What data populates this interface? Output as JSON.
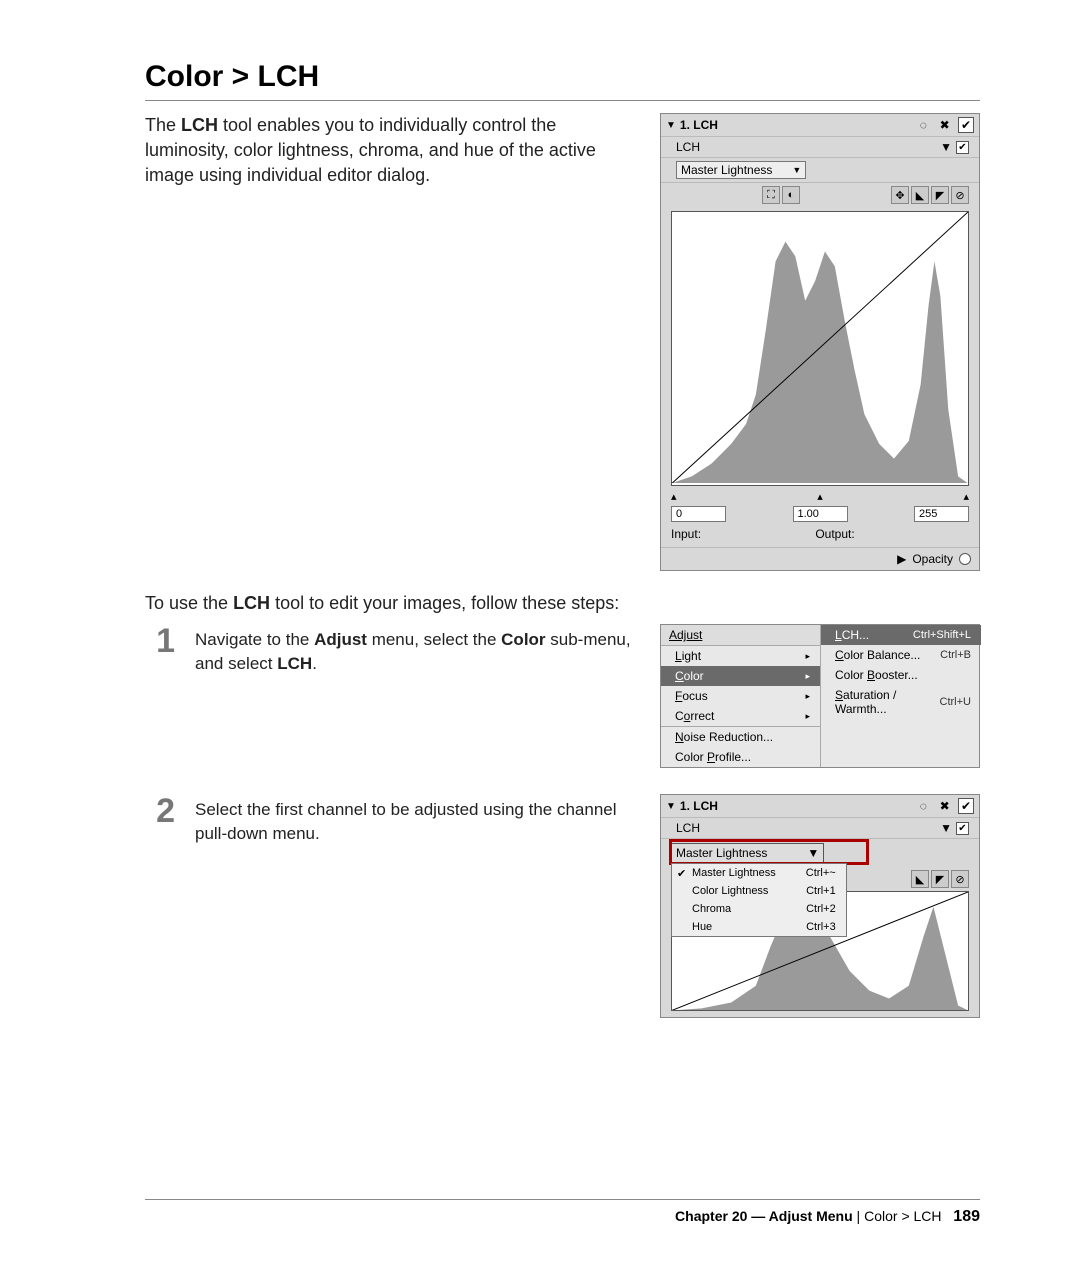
{
  "heading": "Color > LCH",
  "intro": "The LCH tool enables you to individually control the luminosity, color lightness, chroma, and hue of the active image using individual editor dialog.",
  "intro_bold": "LCH",
  "panel1": {
    "title": "1. LCH",
    "type_label": "LCH",
    "channel": "Master Lightness",
    "val_low": "0",
    "val_mid": "1.00",
    "val_high": "255",
    "input_label": "Input:",
    "output_label": "Output:",
    "opacity_label": "Opacity"
  },
  "steps_intro": "To use the LCH tool to edit your images, follow these steps:",
  "step1": {
    "num": "1",
    "text_before": "Navigate to the ",
    "b1": "Adjust",
    "mid1": " menu, select the ",
    "b2": "Color",
    "mid2": " sub-menu, and select ",
    "b3": "LCH",
    "after": "."
  },
  "adjust_menu": {
    "head": "Adjust",
    "items": [
      "Light",
      "Color",
      "Focus",
      "Correct",
      "Noise Reduction...",
      "Color Profile..."
    ],
    "submenu": [
      {
        "label": "LCH...",
        "shortcut": "Ctrl+Shift+L"
      },
      {
        "label": "Color Balance...",
        "shortcut": "Ctrl+B"
      },
      {
        "label": "Color Booster...",
        "shortcut": ""
      },
      {
        "label": "Saturation / Warmth...",
        "shortcut": "Ctrl+U"
      }
    ]
  },
  "step2": {
    "num": "2",
    "text": "Select the first channel to be adjusted using the channel pull-down menu."
  },
  "chan_menu": [
    {
      "label": "Master Lightness",
      "shortcut": "Ctrl+~",
      "checked": true
    },
    {
      "label": "Color Lightness",
      "shortcut": "Ctrl+1",
      "checked": false
    },
    {
      "label": "Chroma",
      "shortcut": "Ctrl+2",
      "checked": false
    },
    {
      "label": "Hue",
      "shortcut": "Ctrl+3",
      "checked": false
    }
  ],
  "footer": {
    "chapter": "Chapter 20 — Adjust Menu",
    "section": "Color > LCH",
    "page": "189"
  }
}
